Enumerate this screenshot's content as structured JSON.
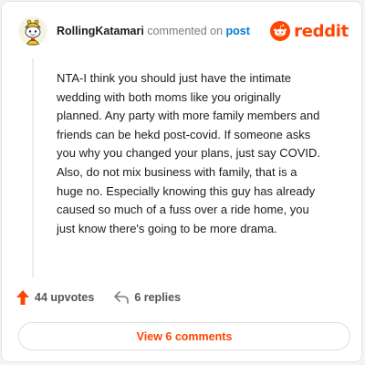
{
  "comment": {
    "username": "RollingKatamari",
    "action_text": "commented on",
    "post_link_text": "post",
    "body": "NTA-I think you should just have the intimate wedding with both moms like you originally planned. Any party with more family members and friends can be hekd post-covid. If someone asks you why you changed your plans, just say COVID. Also, do not mix business with family, that is a huge no. Especially knowing this guy has already caused so much of a fuss over a ride home, you just know there's going to be more drama."
  },
  "brand": {
    "name": "reddit",
    "color": "#ff4500"
  },
  "actions": {
    "upvotes_label": "44 upvotes",
    "replies_label": "6 replies"
  },
  "footer": {
    "view_comments_label": "View 6 comments"
  },
  "icons": {
    "avatar": "snoo-avatar-icon",
    "logo": "reddit-logo-icon",
    "upvote": "upvote-arrow-icon",
    "reply": "reply-arrow-icon"
  }
}
